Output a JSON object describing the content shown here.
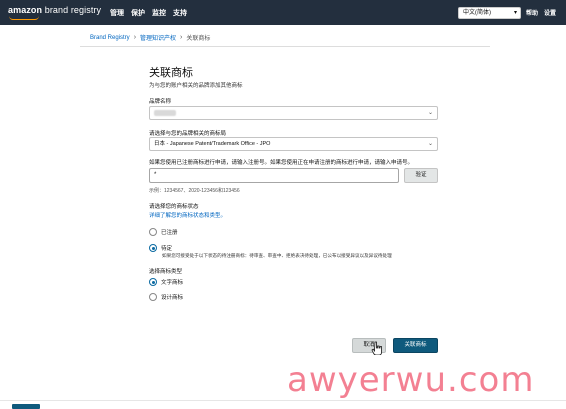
{
  "header": {
    "logo_text_bold": "amazon",
    "logo_text_rest": " brand registry",
    "nav": [
      "管理",
      "保护",
      "监控",
      "支持"
    ],
    "language": "中文(简体)",
    "help_link": "帮助",
    "settings_link": "设置"
  },
  "breadcrumb": {
    "home": "Brand Registry",
    "section": "管理知识产权",
    "current": "关联商标"
  },
  "form": {
    "title": "关联商标",
    "subtitle": "为与您的账户相关的品牌添加其他商标",
    "brand_label": "品牌名称",
    "brand_value": "",
    "office_label": "请选择与您的品牌相关的商标局",
    "office_value": "日本 - Japanese Patent/Trademark Office - JPO",
    "number_label": "如果您使用已注册商标进行申请，请输入注册号。如果您使用正在申请注册的商标进行申请，请输入申请号。",
    "number_value": "*",
    "verify_label": "验证",
    "example_text": "示例：1234567、2020-123456和123456",
    "status_label": "请选择您的商标状态",
    "status_help_link": "详细了解您的商标状态和类型。",
    "status_options": [
      {
        "label": "已注册",
        "selected": false
      },
      {
        "label": "待定",
        "selected": true
      }
    ],
    "pending_desc": "如果您可接受处于以下状态的待注册商标：待审查、审查中、拒绝表决待处理，已公布以接受异议以及异议待处理",
    "type_label": "选择商标类型",
    "type_options": [
      {
        "label": "文字商标",
        "selected": true
      },
      {
        "label": "设计商标",
        "selected": false
      }
    ],
    "cancel_label": "取消",
    "submit_label": "关联商标"
  },
  "watermark": "awyerwu.com",
  "colors": {
    "topbar": "#232f3e",
    "link": "#0066c0",
    "primary": "#0f5a7d",
    "watermark": "#f26a80"
  }
}
